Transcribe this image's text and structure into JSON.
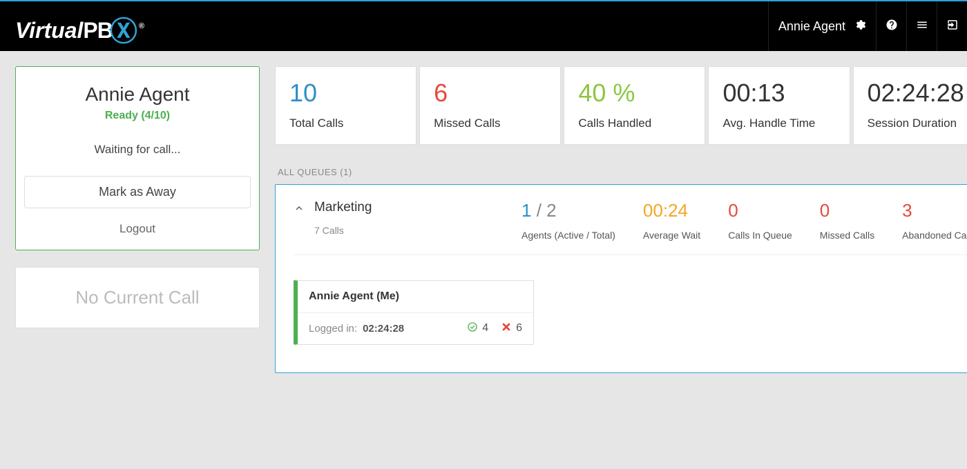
{
  "header": {
    "brand_virtual": "Virtual",
    "brand_pbx": "PB",
    "user_name": "Annie Agent"
  },
  "sidebar": {
    "agent_name": "Annie Agent",
    "status_text": "Ready (4/10)",
    "waiting_text": "Waiting for call...",
    "away_button": "Mark as Away",
    "logout_button": "Logout",
    "no_call_text": "No Current Call"
  },
  "stats": {
    "total_calls": {
      "value": "10",
      "label": "Total Calls"
    },
    "missed_calls": {
      "value": "6",
      "label": "Missed Calls"
    },
    "calls_handled": {
      "value": "40 %",
      "label": "Calls Handled"
    },
    "avg_handle": {
      "value": "00:13",
      "label": "Avg. Handle Time"
    },
    "session_duration": {
      "value": "02:24:28",
      "label": "Session Duration"
    }
  },
  "queues_header": "ALL QUEUES (1)",
  "queue": {
    "name": "Marketing",
    "calls_summary": "7 Calls",
    "agents_active": "1",
    "agents_sep": " / ",
    "agents_total": "2",
    "agents_label": "Agents (Active / Total)",
    "avg_wait": "00:24",
    "avg_wait_label": "Average Wait",
    "in_queue": "0",
    "in_queue_label": "Calls In Queue",
    "missed": "0",
    "missed_label": "Missed Calls",
    "abandoned": "3",
    "abandoned_label": "Abandoned Calls"
  },
  "agent_detail": {
    "name": "Annie Agent (Me)",
    "logged_in_label": "Logged in:",
    "logged_in_time": "02:24:28",
    "handled": "4",
    "missed": "6"
  }
}
